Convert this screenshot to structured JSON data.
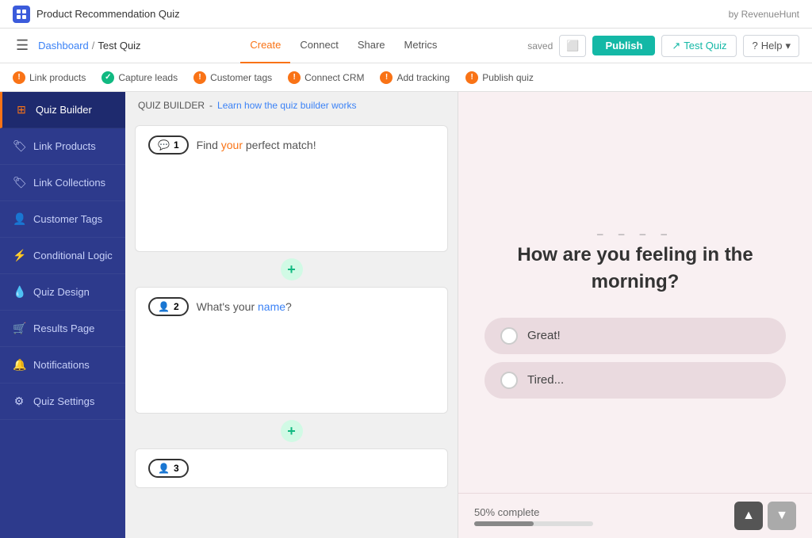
{
  "topbar": {
    "logo_label": "PRQ",
    "app_title": "Product Recommendation Quiz",
    "by_label": "by RevenueHunt"
  },
  "navbar": {
    "menu_icon": "☰",
    "breadcrumb": {
      "dashboard": "Dashboard",
      "separator": "/",
      "current": "Test Quiz"
    },
    "tabs": [
      {
        "label": "Create",
        "active": true
      },
      {
        "label": "Connect",
        "active": false
      },
      {
        "label": "Share",
        "active": false
      },
      {
        "label": "Metrics",
        "active": false
      }
    ],
    "saved_label": "saved",
    "save_icon": "⬜",
    "publish_label": "Publish",
    "test_label": "Test Quiz",
    "help_label": "Help"
  },
  "steps": [
    {
      "label": "Link products",
      "status": "warn"
    },
    {
      "label": "Capture leads",
      "status": "ok"
    },
    {
      "label": "Customer tags",
      "status": "warn"
    },
    {
      "label": "Connect CRM",
      "status": "warn"
    },
    {
      "label": "Add tracking",
      "status": "warn"
    },
    {
      "label": "Publish quiz",
      "status": "warn"
    }
  ],
  "sidebar": {
    "items": [
      {
        "label": "Quiz Builder",
        "icon": "⊞",
        "active": true
      },
      {
        "label": "Link Products",
        "icon": "🏷"
      },
      {
        "label": "Link Collections",
        "icon": "🏷"
      },
      {
        "label": "Customer Tags",
        "icon": "👤"
      },
      {
        "label": "Conditional Logic",
        "icon": "⚡"
      },
      {
        "label": "Quiz Design",
        "icon": "💧"
      },
      {
        "label": "Results Page",
        "icon": "🛒"
      },
      {
        "label": "Notifications",
        "icon": "🔔"
      },
      {
        "label": "Quiz Settings",
        "icon": "⚙"
      }
    ]
  },
  "builder": {
    "header_label": "QUIZ BUILDER",
    "learn_link": "Learn how the quiz builder works",
    "questions": [
      {
        "number": "1",
        "icon": "💬",
        "text_parts": [
          {
            "text": "Find ",
            "style": "normal"
          },
          {
            "text": "your",
            "style": "orange"
          },
          {
            "text": " perfect ",
            "style": "normal"
          },
          {
            "text": "match!",
            "style": "normal"
          }
        ],
        "display_text": "Find your perfect match!"
      },
      {
        "number": "2",
        "icon": "👤",
        "text_parts": [
          {
            "text": "What's your ",
            "style": "normal"
          },
          {
            "text": "name",
            "style": "blue"
          },
          {
            "text": "?",
            "style": "normal"
          }
        ],
        "display_text": "What's your name?"
      }
    ]
  },
  "preview": {
    "question_dashes": "_ _ _ _",
    "question_title": "How are you feeling in the morning?",
    "options": [
      {
        "text": "Great!"
      },
      {
        "text": "Tired..."
      }
    ],
    "progress_label": "50% complete",
    "progress_percent": 50,
    "nav_up": "▲",
    "nav_down": "▼"
  }
}
